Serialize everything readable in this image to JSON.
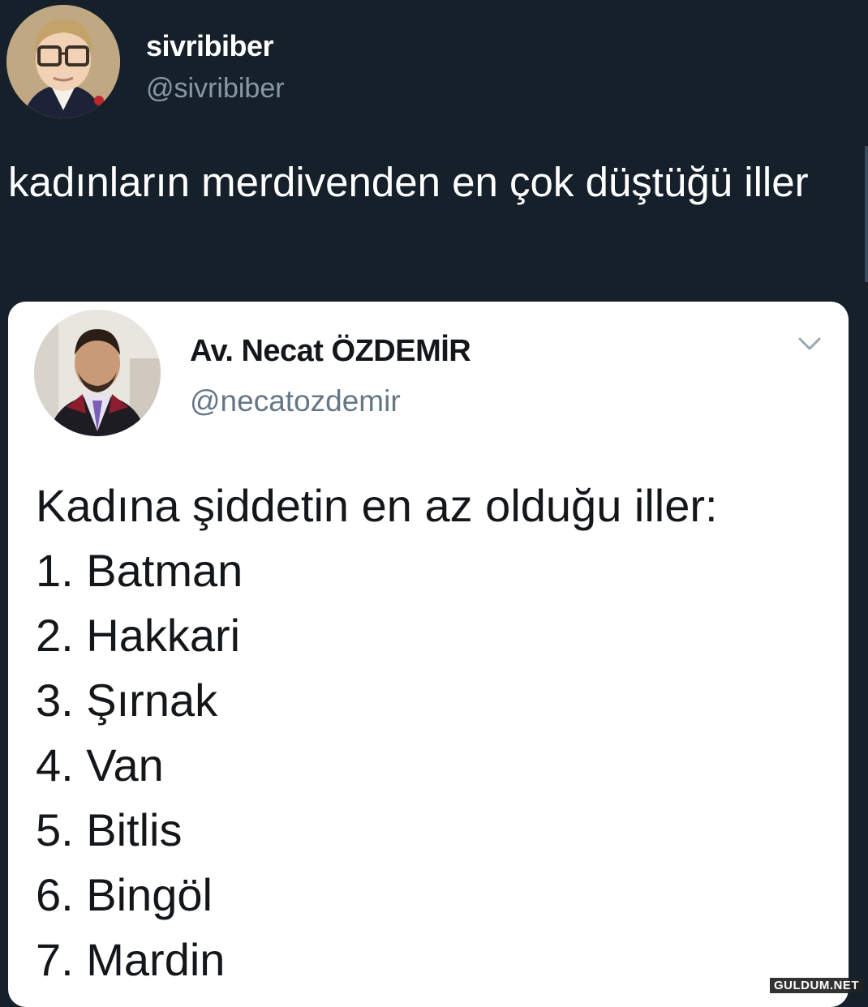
{
  "outer_tweet": {
    "display_name": "sivribiber",
    "handle": "@sivribiber",
    "text": "kadınların merdivenden en çok düştüğü iller"
  },
  "quoted_tweet": {
    "display_name": "Av. Necat ÖZDEMİR",
    "handle": "@necatozdemir",
    "heading": "Kadına şiddetin en az olduğu iller:",
    "items": [
      "1. Batman",
      "2. Hakkari",
      "3. Şırnak",
      "4. Van",
      "5. Bitlis",
      "6. Bingöl",
      "7. Mardin"
    ]
  },
  "watermark": "GULDUM.NET",
  "colors": {
    "background": "#15202b",
    "card": "#ffffff",
    "secondary_text_dark": "#8899a6",
    "secondary_text_light": "#657786"
  },
  "icons": {
    "outer_avatar": "profile-photo-icon",
    "inner_avatar": "profile-photo-icon",
    "chevron": "chevron-down-icon"
  }
}
